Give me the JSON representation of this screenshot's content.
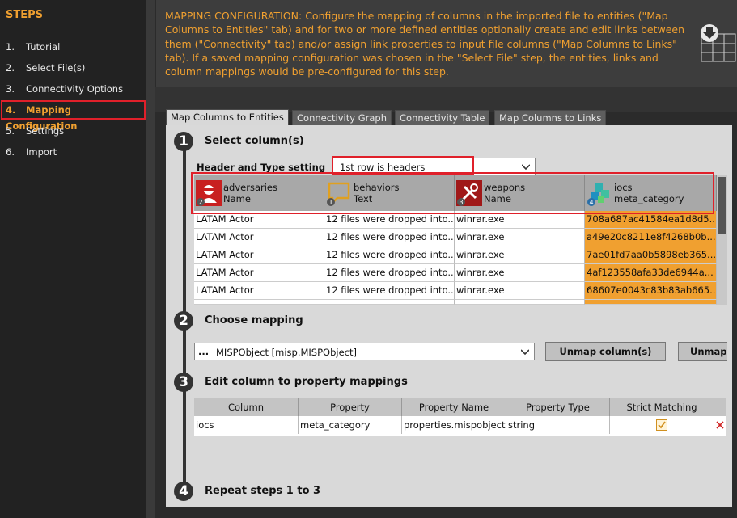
{
  "sidebar": {
    "title": "STEPS",
    "steps": [
      {
        "num": "1.",
        "label": "Tutorial"
      },
      {
        "num": "2.",
        "label": "Select File(s)"
      },
      {
        "num": "3.",
        "label": "Connectivity Options"
      },
      {
        "num": "4.",
        "label": "Mapping Configuration"
      },
      {
        "num": "5.",
        "label": "Settings"
      },
      {
        "num": "6.",
        "label": "Import"
      }
    ]
  },
  "header": {
    "text": "MAPPING CONFIGURATION: Configure the mapping of columns in the imported file to entities (\"Map Columns to Entities\" tab) and for two or more defined entities optionally create and edit links between them (\"Connectivity\" tab) and/or assign link properties to input file columns (\"Map Columns to Links\" tab). If a saved mapping configuration was chosen in the \"Select File\" step, the entities, links and column mappings would be pre-configured for this step."
  },
  "tabs": [
    "Map Columns to Entities",
    "Connectivity Graph",
    "Connectivity Table",
    "Map Columns to Links"
  ],
  "step1": {
    "num": "1",
    "title": "Select column(s)",
    "header_label": "Header and Type setting",
    "header_value": "1st row is headers",
    "columns": [
      {
        "badge": "2",
        "name": "adversaries",
        "type": "Name"
      },
      {
        "badge": "1",
        "name": "behaviors",
        "type": "Text"
      },
      {
        "badge": "3",
        "name": "weapons",
        "type": "Name"
      },
      {
        "badge": "4",
        "name": "iocs",
        "type": "meta_category"
      }
    ],
    "rows": [
      [
        "LATAM Actor",
        "12 files were dropped into...",
        "winrar.exe",
        "708a687ac41584ea1d8d5..."
      ],
      [
        "LATAM Actor",
        "12 files were dropped into...",
        "winrar.exe",
        "a49e20c8211e8f4268b0b..."
      ],
      [
        "LATAM Actor",
        "12 files were dropped into...",
        "winrar.exe",
        "7ae01fd7aa0b5898eb365..."
      ],
      [
        "LATAM Actor",
        "12 files were dropped into...",
        "winrar.exe",
        "4af123558afa33de6944a..."
      ],
      [
        "LATAM Actor",
        "12 files were dropped into...",
        "winrar.exe",
        "68607e0043c83b83ab665..."
      ]
    ]
  },
  "step2": {
    "num": "2",
    "title": "Choose mapping",
    "ellipsis": "...",
    "mapping_value": "MISPObject [misp.MISPObject]",
    "unmap_columns": "Unmap column(s)",
    "unmap": "Unmap"
  },
  "step3": {
    "num": "3",
    "title": "Edit column to property mappings",
    "headers": [
      "Column",
      "Property",
      "Property Name",
      "Property Type",
      "Strict Matching"
    ],
    "row": [
      "iocs",
      "meta_category",
      "properties.mispobject",
      "string"
    ]
  },
  "step4": {
    "num": "4",
    "title": "Repeat steps 1 to 3"
  },
  "colors": {
    "accent": "#f0a030",
    "highlight": "#e0202a"
  }
}
